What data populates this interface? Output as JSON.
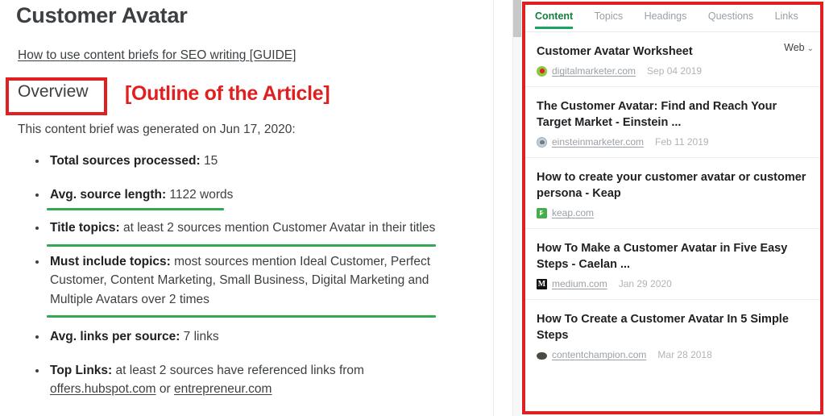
{
  "brief": {
    "title": "Customer Avatar",
    "guide_link": "How to use content briefs for SEO writing [GUIDE]",
    "section_label": "Overview",
    "annotation": "[Outline of the Article]",
    "generated_line": "This content brief was generated on Jun 17, 2020:",
    "bullets": [
      {
        "label": "Total sources processed:",
        "value": " 15"
      },
      {
        "label": "Avg. source length:",
        "value": " 1122 words"
      },
      {
        "label": "Title topics:",
        "value": " at least 2 sources mention Customer Avatar in their titles"
      },
      {
        "label": "Must include topics:",
        "value": " most sources mention Ideal Customer, Perfect Customer, Content Marketing, Small Business, Digital Marketing and Multiple Avatars over 2 times"
      },
      {
        "label": "Avg. links per source:",
        "value": " 7 links"
      },
      {
        "label": "Top Links:",
        "value": " at least 2 sources have referenced links from "
      }
    ],
    "top_links": {
      "link_one": "offers.hubspot.com",
      "separator": " or ",
      "link_two": "entrepreneur.com"
    }
  },
  "serp": {
    "tabs": [
      {
        "label": "Content",
        "active": true
      },
      {
        "label": "Topics",
        "active": false
      },
      {
        "label": "Headings",
        "active": false
      },
      {
        "label": "Questions",
        "active": false
      },
      {
        "label": "Links",
        "active": false
      }
    ],
    "source_selector": {
      "label": "Web",
      "chevron": "⌄"
    },
    "results": [
      {
        "title": "Customer Avatar Worksheet",
        "domain": "digitalmarketer.com",
        "date": "Sep 04 2019",
        "favicon": "digitalmarketer-favicon"
      },
      {
        "title": "The Customer Avatar: Find and Reach Your Target Market - Einstein ...",
        "domain": "einsteinmarketer.com",
        "date": "Feb 11 2019",
        "favicon": "einsteinmarketer-favicon"
      },
      {
        "title": "How to create your customer avatar or customer persona - Keap",
        "domain": "keap.com",
        "date": "",
        "favicon": "keap-favicon"
      },
      {
        "title": "How To Make a Customer Avatar in Five Easy Steps - Caelan ...",
        "domain": "medium.com",
        "date": "Jan 29 2020",
        "favicon": "medium-favicon"
      },
      {
        "title": "How To Create a Customer Avatar In 5 Simple Steps",
        "domain": "contentchampion.com",
        "date": "Mar 28 2018",
        "favicon": "contentchampion-favicon"
      }
    ]
  },
  "colors": {
    "annotation_red": "#e02020",
    "highlight_green": "#34a853",
    "active_tab_green": "#15803d",
    "text_primary": "#3c4043",
    "text_muted": "#9aa0a6"
  }
}
